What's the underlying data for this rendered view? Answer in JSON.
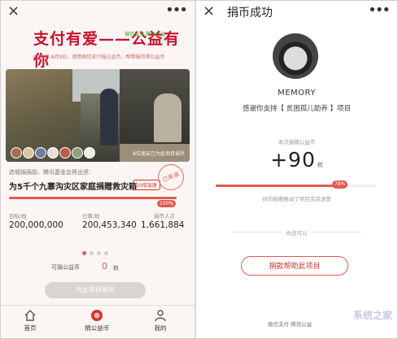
{
  "left": {
    "close": "×",
    "more": "•••",
    "hero_title": "支付有爱——公益有你",
    "hero_brand": "微信支付 腾讯公益",
    "hero_sub": "8月9日-8月9日，使用微信支付捐公益币，帮帮捐可得公益币",
    "photo_caption": "8位朋友已为此项目捐币",
    "project_pre": "选城捐捐投、腾讯基金会将出资：",
    "project_title": "为5千个九寨沟灾区家庭捐赠救灾箱",
    "tag": "10倍加速",
    "stamp": "已筹满",
    "progress_badge": "100%",
    "progress_percent": 100,
    "stats": [
      {
        "label": "目标/枚",
        "value": "200,000,000"
      },
      {
        "label": "已筹/枚",
        "value": "200,453,340"
      },
      {
        "label": "捐币人次",
        "value": "1,661,884"
      }
    ],
    "coins_label": "可捐公益币",
    "coins_value": "0",
    "coins_unit": "枚",
    "donate_button": "为此项目捐币",
    "tabs": [
      {
        "label": "首页"
      },
      {
        "label": "捐公益币"
      },
      {
        "label": "我的"
      }
    ]
  },
  "right": {
    "close": "×",
    "title": "捐币成功",
    "more": "•••",
    "username": "MEMORY",
    "thanks": "感谢你支持【 贫困孤儿助养 】项目",
    "coin_label": "本次捐赠公益币",
    "coin_amount": "+90",
    "coin_unit": "枚",
    "progress_badge": "78%",
    "progress_percent": 78,
    "progress_caption": "你的捐赠推动了项目完成进度",
    "separator_text": "你还可以",
    "help_button": "捐款帮助此项目",
    "footer_brand": "微信支付 腾讯公益",
    "watermark": "系统之家"
  },
  "colors": {
    "accent": "#e05a52",
    "brand_red": "#c8102e"
  }
}
